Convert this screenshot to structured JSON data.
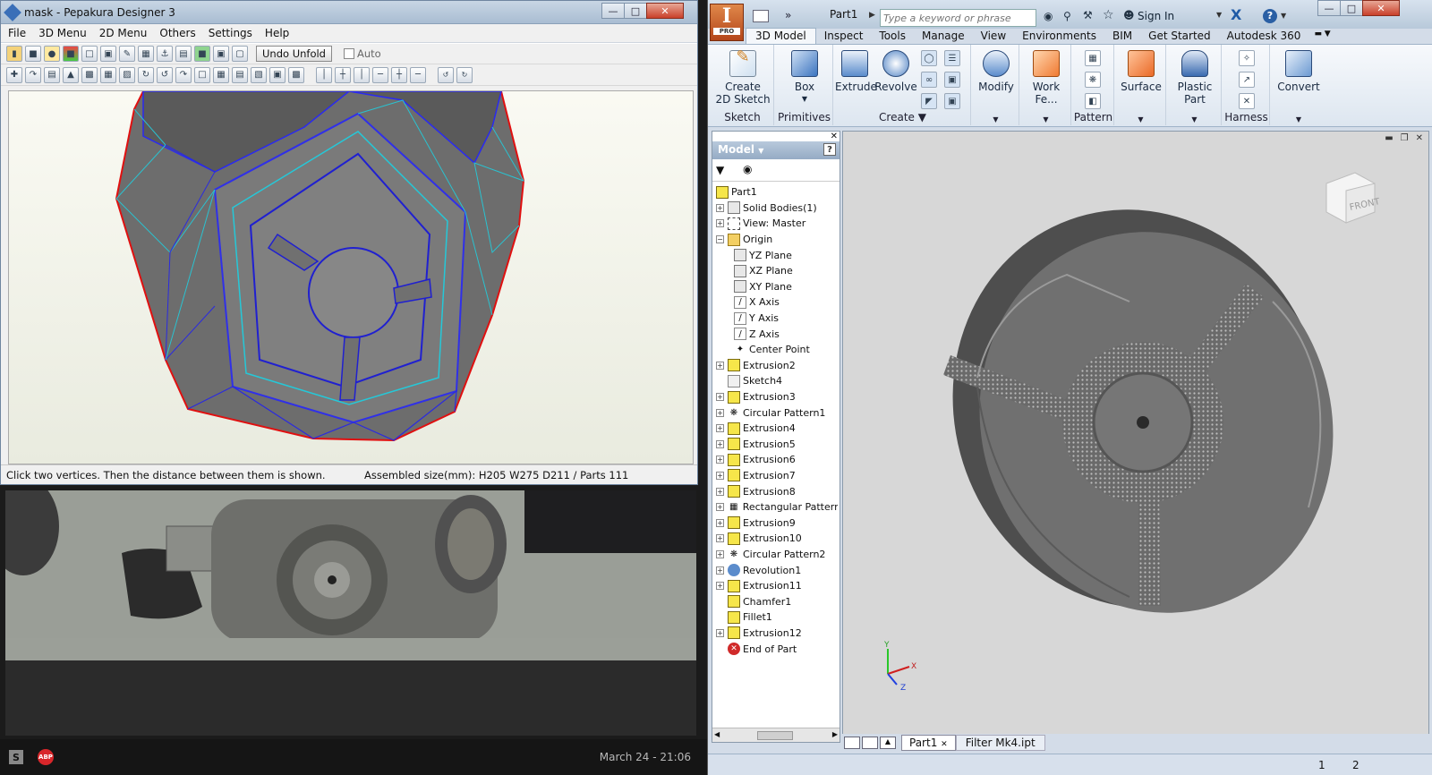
{
  "pepakura": {
    "title": "mask - Pepakura Designer 3",
    "menu": [
      "File",
      "3D Menu",
      "2D Menu",
      "Others",
      "Settings",
      "Help"
    ],
    "undo_unfold": "Undo Unfold",
    "auto_label": "Auto",
    "status_hint": "Click two vertices. Then the distance between them is shown.",
    "status_size": "Assembled size(mm): H205 W275 D211 / Parts 111"
  },
  "taskbar": {
    "datetime": "March 24 - 21:06",
    "abp": "ABP",
    "s": "S"
  },
  "inventor": {
    "app_badge": "PRO",
    "document_title": "Part1",
    "search_placeholder": "Type a keyword or phrase",
    "sign_in": "Sign In",
    "help": "?",
    "tabs": [
      "3D Model",
      "Inspect",
      "Tools",
      "Manage",
      "View",
      "Environments",
      "BIM",
      "Get Started",
      "Autodesk 360"
    ],
    "ribbon": {
      "create_2d_sketch": [
        "Create",
        "2D Sketch"
      ],
      "sketch": "Sketch",
      "box": "Box",
      "primitives": "Primitives",
      "extrude": "Extrude",
      "revolve": "Revolve",
      "create": "Create",
      "modify": "Modify",
      "work_features": "Work Fe...",
      "pattern": "Pattern",
      "surface": "Surface",
      "plastic_part": "Plastic Part",
      "harness": "Harness",
      "convert": "Convert"
    },
    "browser_title": "Model",
    "tree": [
      {
        "label": "Part1",
        "icon": "part-icon"
      },
      {
        "label": "Solid Bodies(1)",
        "icon": "solid-bodies-icon"
      },
      {
        "label": "View: Master",
        "icon": "view-icon"
      },
      {
        "label": "Origin",
        "icon": "folder-icon"
      },
      {
        "label": "YZ Plane",
        "icon": "plane-icon"
      },
      {
        "label": "XZ Plane",
        "icon": "plane-icon"
      },
      {
        "label": "XY Plane",
        "icon": "plane-icon"
      },
      {
        "label": "X Axis",
        "icon": "axis-icon"
      },
      {
        "label": "Y Axis",
        "icon": "axis-icon"
      },
      {
        "label": "Z Axis",
        "icon": "axis-icon"
      },
      {
        "label": "Center Point",
        "icon": "point-icon"
      },
      {
        "label": "Extrusion2",
        "icon": "extrusion-icon"
      },
      {
        "label": "Sketch4",
        "icon": "sketch-icon"
      },
      {
        "label": "Extrusion3",
        "icon": "extrusion-icon"
      },
      {
        "label": "Circular Pattern1",
        "icon": "pattern-icon"
      },
      {
        "label": "Extrusion4",
        "icon": "extrusion-icon"
      },
      {
        "label": "Extrusion5",
        "icon": "extrusion-icon"
      },
      {
        "label": "Extrusion6",
        "icon": "extrusion-icon"
      },
      {
        "label": "Extrusion7",
        "icon": "extrusion-icon"
      },
      {
        "label": "Extrusion8",
        "icon": "extrusion-icon"
      },
      {
        "label": "Rectangular Pattern",
        "icon": "pattern-icon"
      },
      {
        "label": "Extrusion9",
        "icon": "extrusion-icon"
      },
      {
        "label": "Extrusion10",
        "icon": "extrusion-icon"
      },
      {
        "label": "Circular Pattern2",
        "icon": "pattern-icon"
      },
      {
        "label": "Revolution1",
        "icon": "revolve-icon"
      },
      {
        "label": "Extrusion11",
        "icon": "extrusion-icon"
      },
      {
        "label": "Chamfer1",
        "icon": "extrusion-icon"
      },
      {
        "label": "Fillet1",
        "icon": "extrusion-icon"
      },
      {
        "label": "Extrusion12",
        "icon": "extrusion-icon"
      },
      {
        "label": "End of Part",
        "icon": "end-of-part-icon"
      }
    ],
    "viewcube_label": "FRONT",
    "axes": {
      "x": "X",
      "y": "Y",
      "z": "Z"
    },
    "doc_tabs": [
      "Part1",
      "Filter Mk4.ipt"
    ],
    "status_nums": [
      "1",
      "2"
    ]
  }
}
